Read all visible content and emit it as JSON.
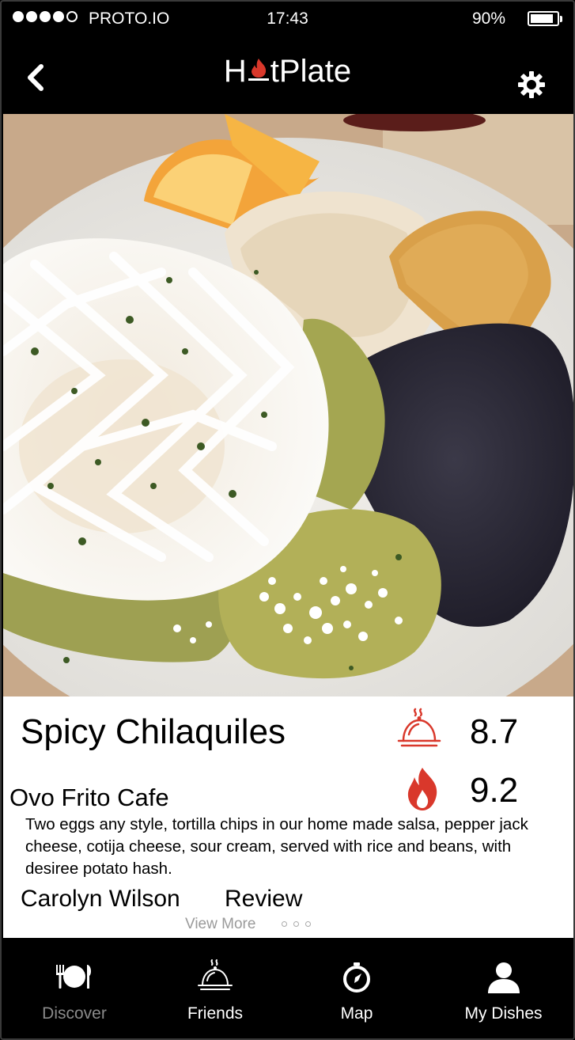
{
  "status_bar": {
    "carrier": "PROTO.IO",
    "time": "17:43",
    "battery_percent": "90%",
    "battery_level": 0.9,
    "signal_bars_filled": 4,
    "signal_bars_total": 5
  },
  "nav": {
    "logo_prefix": "H",
    "logo_suffix": "tPlate",
    "back_icon": "chevron-left-icon",
    "settings_icon": "gear-icon"
  },
  "dish": {
    "name": "Spicy Chilaquiles",
    "restaurant": "Ovo Frito Cafe",
    "description": "Two eggs any style, tortilla chips in our home made salsa, pepper jack cheese, cotija cheese, sour cream, served with rice and beans, with desiree potato hash.",
    "reviewer": "Carolyn Wilson",
    "review_label": "Review",
    "view_more_label": "View More"
  },
  "ratings": {
    "dish_rating": "8.7",
    "spice_rating": "9.2",
    "accent_color": "#d9382b"
  },
  "tabs": [
    {
      "label": "Discover",
      "icon": "plate-cutlery-icon",
      "active": true
    },
    {
      "label": "Friends",
      "icon": "cloche-icon",
      "active": false
    },
    {
      "label": "Map",
      "icon": "compass-icon",
      "active": false
    },
    {
      "label": "My Dishes",
      "icon": "user-icon",
      "active": false
    }
  ]
}
